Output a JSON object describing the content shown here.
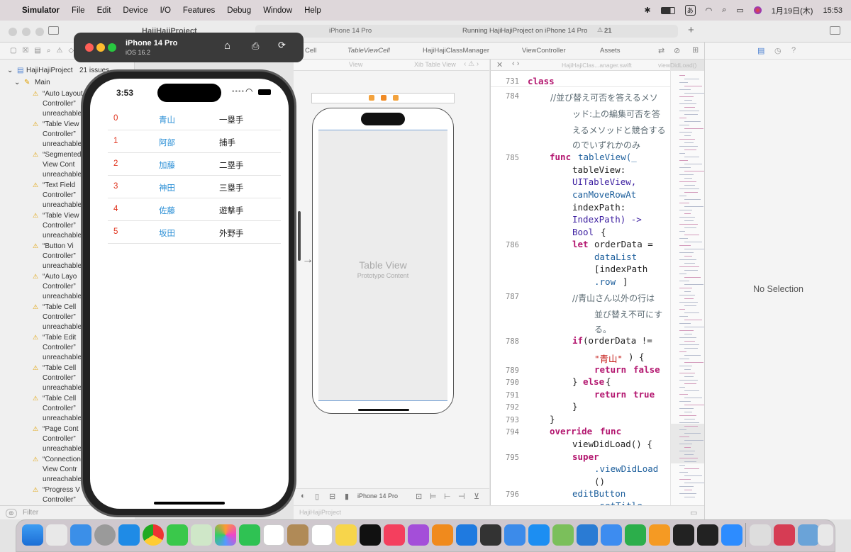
{
  "menubar": {
    "app": "Simulator",
    "items": [
      "File",
      "Edit",
      "Device",
      "I/O",
      "Features",
      "Debug",
      "Window",
      "Help"
    ],
    "ime": "あ",
    "date": "1月19日(木)",
    "time": "15:53"
  },
  "xcode": {
    "project_tab": "HajiHajiProject",
    "scheme_device": "iPhone 14 Pro",
    "status": "Running HajiHajiProject on iPhone 14 Pro",
    "warnings_count": "21",
    "tabs": [
      "TableViewCell",
      "HajiHajiClassManager",
      "ViewController",
      "Assets"
    ],
    "partial_tab": "Cell",
    "canvas_breadcrumb": [
      "View",
      "Xib Table View"
    ],
    "editor_breadcrumb": [
      "HajiHajiClas...anager.swift",
      "viewDidLoad()"
    ],
    "bottom_crumb": "HajiHajiProject"
  },
  "navigator": {
    "project": "HajiHajiProject",
    "issues": "21 issues",
    "group": "Main",
    "items": [
      {
        "l1": "“Auto Layout",
        "l2": "Controller”",
        "l3": "unreachable"
      },
      {
        "l1": "“Table View",
        "l2": "Controller”",
        "l3": "unreachable"
      },
      {
        "l1": "“Segmented",
        "l2": "View Cont",
        "l3": "unreachable"
      },
      {
        "l1": "“Text Field",
        "l2": "Controller”",
        "l3": "unreachable"
      },
      {
        "l1": "“Table View",
        "l2": "Controller”",
        "l3": "unreachable"
      },
      {
        "l1": "“Button Vi",
        "l2": "Controller”",
        "l3": "unreachable"
      },
      {
        "l1": "“Auto Layo",
        "l2": "Controller”",
        "l3": "unreachable"
      },
      {
        "l1": "“Table Cell",
        "l2": "Controller”",
        "l3": "unreachable"
      },
      {
        "l1": "“Table Edit",
        "l2": "Controller”",
        "l3": "unreachable"
      },
      {
        "l1": "“Table Cell",
        "l2": "Controller”",
        "l3": "unreachable"
      },
      {
        "l1": "“Table Cell",
        "l2": "Controller”",
        "l3": "unreachable"
      },
      {
        "l1": "“Page Cont",
        "l2": "Controller”",
        "l3": "unreachable"
      },
      {
        "l1": "“Connection",
        "l2": "View Contr",
        "l3": "unreachable"
      },
      {
        "l1": "“Progress V",
        "l2": "Controller”",
        "l3": ""
      }
    ],
    "filter_placeholder": "Filter"
  },
  "simulator": {
    "device": "iPhone 14 Pro",
    "os": "iOS 16.2",
    "status_time": "3:53",
    "rows": [
      {
        "num": "0",
        "name": "青山",
        "pos": "一塁手"
      },
      {
        "num": "1",
        "name": "阿部",
        "pos": "捕手"
      },
      {
        "num": "2",
        "name": "加藤",
        "pos": "二塁手"
      },
      {
        "num": "3",
        "name": "神田",
        "pos": "三塁手"
      },
      {
        "num": "4",
        "name": "佐藤",
        "pos": "遊撃手"
      },
      {
        "num": "5",
        "name": "坂田",
        "pos": "外野手"
      }
    ]
  },
  "canvas": {
    "table_title": "Table View",
    "table_sub": "Prototype Content",
    "device_label": "iPhone 14 Pro"
  },
  "editor": {
    "lines": {
      "l731": "731",
      "l784": "784",
      "l785": "785",
      "l786": "786",
      "l787": "787",
      "l788": "788",
      "l789": "789",
      "l790": "790",
      "l791": "791",
      "l792": "792",
      "l793": "793",
      "l794": "794",
      "l795": "795",
      "l796": "796"
    },
    "code": {
      "class_kw": "class",
      "c784a": "//並び替え可否を答えるメソ",
      "c784b": "ッド:上の編集可否を答",
      "c784c": "えるメソッドと競合する",
      "c784d": "のでいずれかのみ",
      "func": "func",
      "tv_fn": "tableView(_",
      "tv_param": "tableView:",
      "tv_type": "UITableView,",
      "can_move": "canMoveRowAt",
      "ip_label": "indexPath:",
      "ip_type": "IndexPath) ->",
      "bool_t": "Bool",
      "brace_open": "{",
      "let_kw": "let",
      "order_data": "orderData =",
      "data_list": "dataList",
      "ip_index": "[indexPath",
      "row": ".row",
      "row_close": "]",
      "c787a": "//青山さん以外の行は",
      "c787b": "並び替え不可にす",
      "c787c": "る。",
      "if_kw": "if",
      "if_expr": "(orderData !=",
      "if_str": "\"青山\"",
      "if_close": ") {",
      "return_kw": "return",
      "false_kw": "false",
      "else_open": "} ",
      "else_kw": "else",
      "else_brace": " {",
      "true_kw": "true",
      "brace_close": "}",
      "override_kw": "override",
      "view_did_load": "viewDidLoad() {",
      "super_kw": "super",
      "vdl_call": ".viewDidLoad",
      "parens": "()",
      "edit_button": "editButton",
      "set_title": ".setTitle"
    }
  },
  "inspector": {
    "empty": "No Selection"
  },
  "colors": {
    "number": "#e0321c",
    "name": "#2b8fd6",
    "keyword": "#b3166f"
  }
}
